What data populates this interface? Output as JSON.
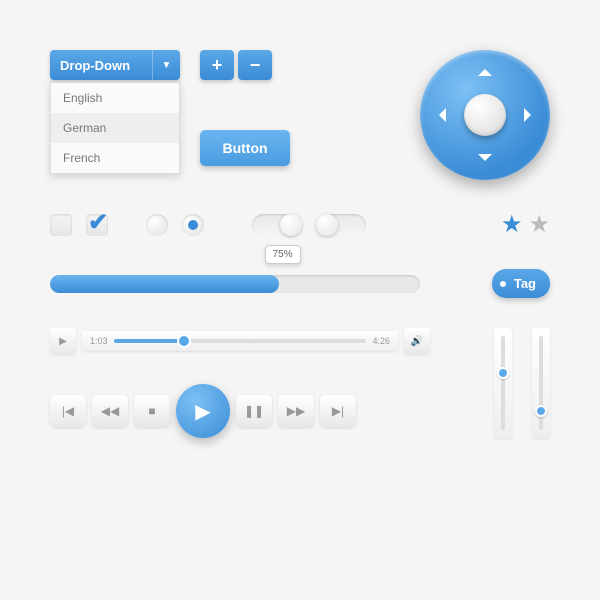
{
  "dropdown": {
    "label": "Drop-Down",
    "items": [
      "English",
      "German",
      "French"
    ],
    "selected_index": 1
  },
  "plus_minus": {
    "plus": "+",
    "minus": "−"
  },
  "button": {
    "label": "Button"
  },
  "progress": {
    "percent_label": "75%",
    "fill_pct": 62
  },
  "tag": {
    "label": "Tag"
  },
  "audio": {
    "elapsed": "1:03",
    "total": "4:26"
  },
  "vsliders": [
    {
      "pos": 35
    },
    {
      "pos": 70
    }
  ],
  "colors": {
    "accent": "#3a8cd6"
  }
}
